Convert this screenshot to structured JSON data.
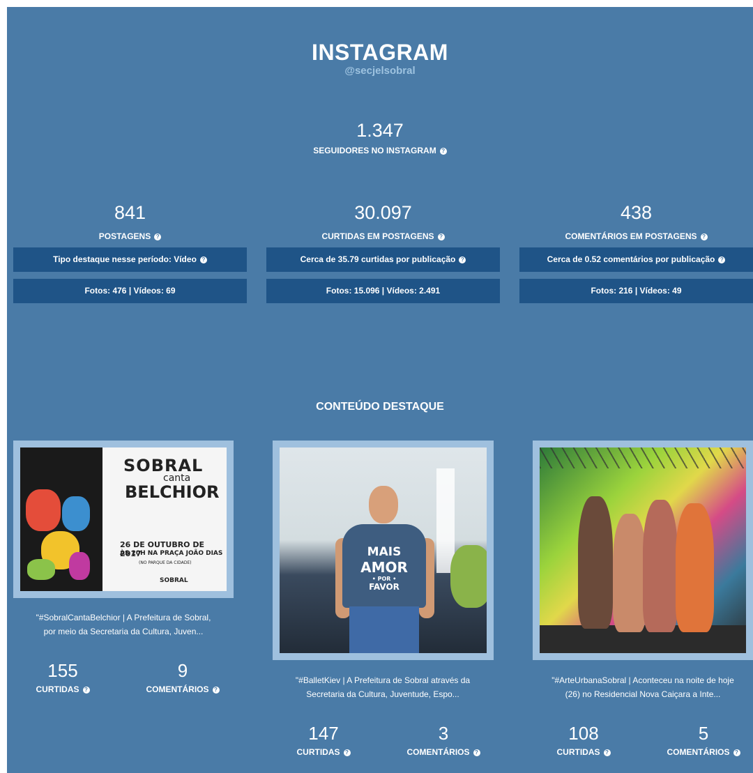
{
  "header": {
    "title": "INSTAGRAM",
    "handle": "@secjelsobral"
  },
  "followers": {
    "value": "1.347",
    "label": "SEGUIDORES NO INSTAGRAM"
  },
  "stats": [
    {
      "value": "841",
      "label": "POSTAGENS",
      "highlight": "Tipo destaque nesse período: Vídeo",
      "breakdown": "Fotos: 476 | Vídeos: 69"
    },
    {
      "value": "30.097",
      "label": "CURTIDAS EM POSTAGENS",
      "highlight": "Cerca de 35.79 curtidas por publicação",
      "breakdown": "Fotos: 15.096 | Vídeos: 2.491"
    },
    {
      "value": "438",
      "label": "COMENTÁRIOS EM POSTAGENS",
      "highlight": "Cerca de 0.52 comentários por publicação",
      "breakdown": "Fotos: 216 | Vídeos: 49"
    }
  ],
  "featured": {
    "title": "CONTEÚDO DESTAQUE",
    "likes_label": "CURTIDAS",
    "comments_label": "COMENTÁRIOS",
    "posts": [
      {
        "caption_line1": "\"#SobralCantaBelchior | A Prefeitura de Sobral,",
        "caption_line2": "por meio da Secretaria da Cultura, Juven...",
        "likes": "155",
        "comments": "9",
        "poster": {
          "l1": "SOBRAL",
          "l2": "canta",
          "l3": "BELCHIOR",
          "l4": "26 DE OUTUBRO DE 2017",
          "l5": "ÀS 20H NA PRAÇA JOÃO DIAS",
          "l6": "(NO PARQUE DA CIDADE)",
          "l7": "SOBRAL"
        }
      },
      {
        "caption_line1": "\"#BalletKiev | A Prefeitura de Sobral através da",
        "caption_line2": "Secretaria da Cultura, Juventude, Espo...",
        "likes": "147",
        "comments": "3",
        "shirt": {
          "l1": "MAIS",
          "l2": "AMOR",
          "l3": "• POR •",
          "l4": "FAVOR"
        }
      },
      {
        "caption_line1": "\"#ArteUrbanaSobral | Aconteceu na noite de hoje",
        "caption_line2": "(26) no Residencial Nova Caiçara a Inte...",
        "likes": "108",
        "comments": "5"
      }
    ]
  },
  "icons": {
    "help": "?"
  },
  "colors": {
    "panel": "#4a7ba7",
    "bar": "#1f5487",
    "frame": "#9fc0de",
    "handle": "#9ec3e0"
  }
}
